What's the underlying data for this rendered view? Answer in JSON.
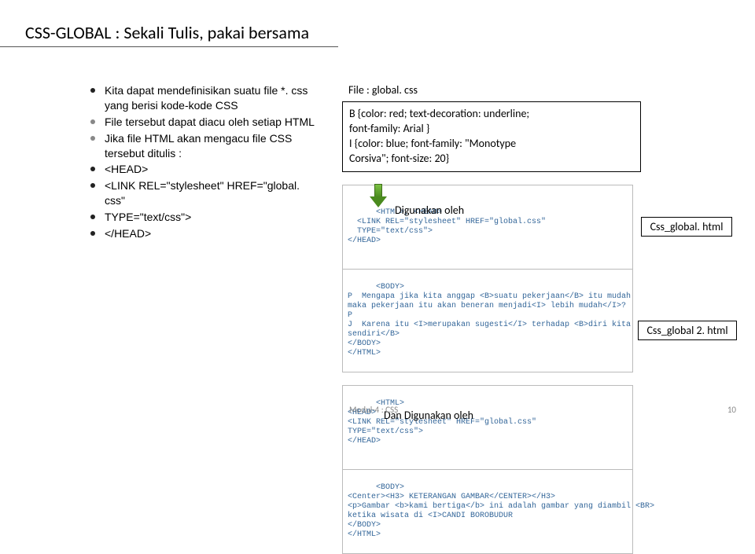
{
  "title": "CSS-GLOBAL : Sekali Tulis, pakai bersama",
  "bullets": {
    "b0": "Kita dapat mendefinisikan suatu file *. css yang berisi kode-kode CSS",
    "b1": "File tersebut dapat diacu oleh setiap HTML",
    "b2": "Jika file HTML akan mengacu file CSS tersebut ditulis :",
    "b3": " <HEAD>",
    "b4": "<LINK REL=\"stylesheet\" HREF=\"global. css\"",
    "b5": " TYPE=\"text/css\">",
    "b6": "</HEAD>"
  },
  "file_label": "File : global. css",
  "css_box": {
    "l1": "B {color: red; text-decoration: underline;",
    "l2": "   font-family: Arial }",
    "l3": " I {color: blue; font-family: \"Monotype",
    "l4": "Corsiva\";  font-size: 20}"
  },
  "code1": {
    "head": "<HTML>, <HEAD>\n  <LINK REL=\"stylesheet\" HREF=\"global.css\"\n  TYPE=\"text/css\">\n</HEAD>",
    "overlay": "Digunakan oleh",
    "body": "<BODY>\nP  Mengapa jika kita anggap <B>suatu pekerjaan</B> itu mudah\nmaka pekerjaan itu akan beneran menjadi<I> lebih mudah</I>?\nP\nJ  Karena itu <I>merupakan sugesti</I> terhadap <B>diri kita\nsendiri</B>\n</BODY>\n</HTML>"
  },
  "code2": {
    "head": "<HTML>\n<HEAD>\n<LINK REL=\"stylesheet\" HREF=\"global.css\"\nTYPE=\"text/css\">\n</HEAD>",
    "overlay": "Dan Digunakan oleh",
    "body": "<BODY>\n<Center><H3> KETERANGAN GAMBAR</CENTER></H3>\n<p>Gambar <b>kami bertiga</b> ini adalah gambar yang diambil <BR>\nketika wisata di <I>CANDI BOROBUDUR\n</BODY>\n</HTML>"
  },
  "tags": {
    "t1": "Css_global. html",
    "t2": "Css_global 2. html"
  },
  "footer": {
    "left": "Modul-4 : CSS",
    "right": "10"
  }
}
